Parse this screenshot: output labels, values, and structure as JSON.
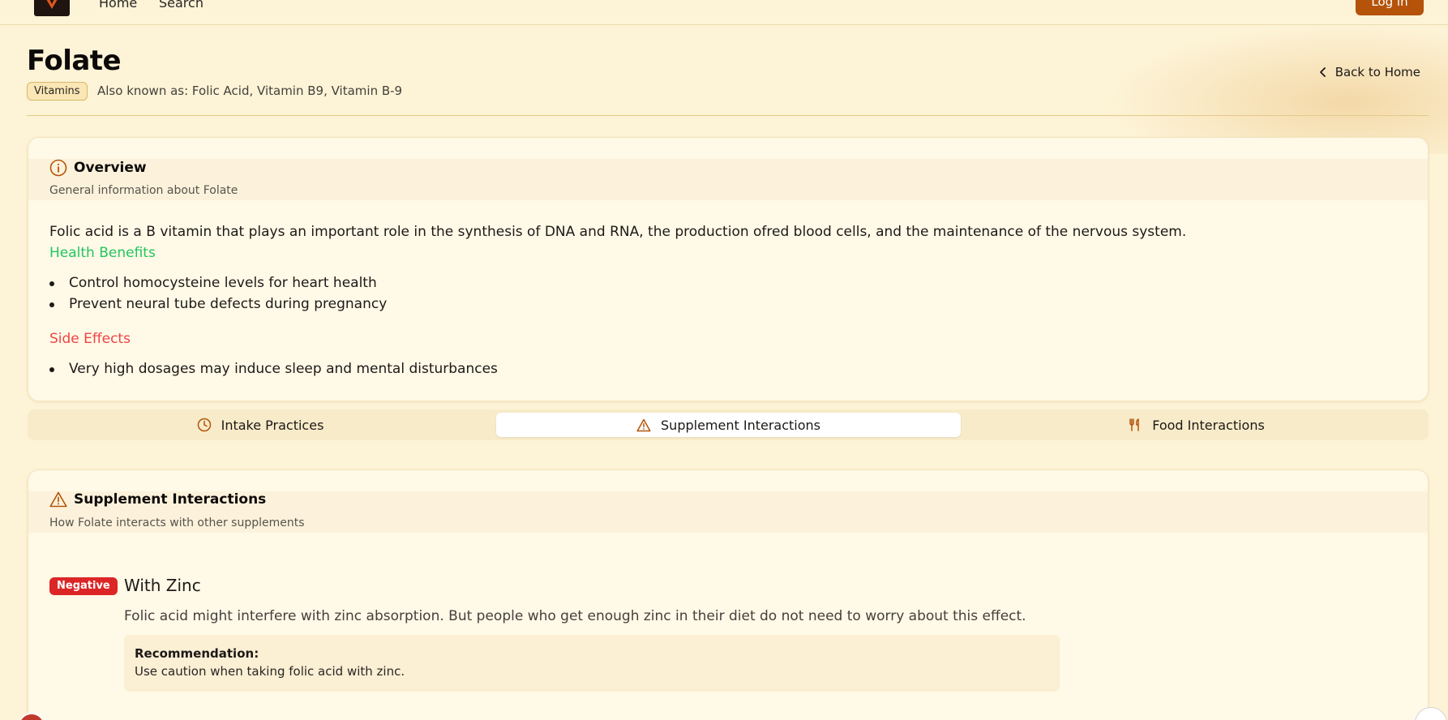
{
  "nav": {
    "home_label": "Home",
    "search_label": "Search",
    "login_label": "Log in"
  },
  "header": {
    "title": "Folate",
    "category": "Vitamins",
    "aka": "Also known as: Folic Acid, Vitamin B9, Vitamin B-9",
    "back_label": "Back to Home"
  },
  "overview": {
    "title": "Overview",
    "subtitle": "General information about Folate",
    "description": "Folic acid is a B vitamin that plays an important role in the synthesis of DNA and RNA, the production ofred blood cells, and the maintenance of the nervous system.",
    "benefits_heading": "Health Benefits",
    "benefits": [
      "Control homocysteine levels for heart health",
      "Prevent neural tube defects during pregnancy"
    ],
    "side_effects_heading": "Side Effects",
    "side_effects": [
      "Very high dosages may induce sleep and mental disturbances"
    ]
  },
  "tabs": [
    {
      "label": "Intake Practices",
      "icon": "clock-icon"
    },
    {
      "label": "Supplement Interactions",
      "icon": "warning-icon"
    },
    {
      "label": "Food Interactions",
      "icon": "utensils-icon"
    }
  ],
  "active_tab": "Supplement Interactions",
  "interactions": {
    "title": "Supplement Interactions",
    "subtitle": "How Folate interacts with other supplements",
    "items": [
      {
        "badge": "Negative",
        "title": "With Zinc",
        "description": "Folic acid might interfere with zinc absorption. But people who get enough zinc in their diet do not need to worry about this effect.",
        "recommendation_label": "Recommendation:",
        "recommendation": "Use caution when taking folic acid with zinc."
      }
    ]
  },
  "colors": {
    "accent": "#b45309",
    "benefits": "#22c55e",
    "side_effects": "#ef4444",
    "negative": "#dc2626",
    "background": "#fdf3d6"
  }
}
